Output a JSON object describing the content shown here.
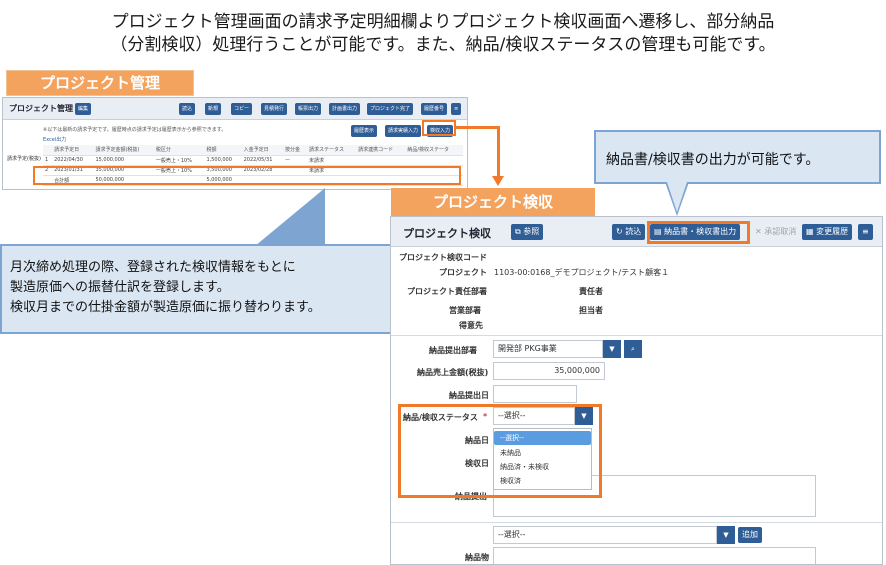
{
  "caption": {
    "line1": "プロジェクト管理画面の請求予定明細欄よりプロジェクト検収画面へ遷移し、部分納品",
    "line2": "（分割検収）処理行うことが可能です。また、納品/検収ステータスの管理も可能です。"
  },
  "pm": {
    "section_label": "プロジェクト管理",
    "window_title": "プロジェクト管理",
    "edit_button": "編集",
    "toolbar": [
      "読込",
      "新規",
      "コピー",
      "見積発行",
      "帳票出力",
      "計画書出力",
      "プロジェクト完了",
      "履歴番号"
    ],
    "history_button": "履歴表示",
    "invoice_button": "請求実績入力",
    "acceptance_button": "検収入力",
    "note": "※以下は最新の請求予定です。履歴時点の請求予定は履歴表示から参照できます。",
    "excel_link": "Excel出力",
    "side_label": "請求予定(税抜)",
    "columns": [
      "",
      "請求予定日",
      "請求予定金額(税抜)",
      "税区分",
      "税額",
      "入金予定日",
      "按分金",
      "請求ステータス",
      "請求連携コード",
      "納品/検収ステータ"
    ],
    "rows": [
      [
        "1",
        "2022/04/30",
        "15,000,000",
        "一般売上・10%",
        "1,500,000",
        "2022/05/31",
        "ー",
        "未請求",
        "",
        ""
      ],
      [
        "2",
        "2023/01/31",
        "35,000,000",
        "一般売上・10%",
        "3,500,000",
        "2023/02/28",
        "",
        "未請求",
        "",
        ""
      ],
      [
        "",
        "合計額",
        "50,000,000",
        "",
        "5,000,000",
        "",
        "",
        "",
        "",
        ""
      ]
    ]
  },
  "callouts": {
    "output": "納品書/検収書の出力が可能です。",
    "monthly_line1": "月次締め処理の際、登録された検収情報をもとに",
    "monthly_line2": "製造原価への振替仕訳を登録します。",
    "monthly_line3": "検収月までの仕掛金額が製造原価に振り替わります。"
  },
  "pa": {
    "section_label": "プロジェクト検収",
    "window_title": "プロジェクト検収",
    "ref_button": "参照",
    "load_button": "読込",
    "output_button": "納品書・検収書出力",
    "cancel_button": "承認取消",
    "history_button": "変更履歴",
    "fields": {
      "code_label": "プロジェクト検収コード",
      "project_label": "プロジェクト",
      "project_value": "1103-00:0168_デモプロジェクト/テスト顧客１",
      "resp_dept_label": "プロジェクト責任部署",
      "resp_person_label": "責任者",
      "sales_dept_label": "営業部署",
      "manager_label": "担当者",
      "customer_label": "得意先",
      "delivery_dept_label": "納品提出部署",
      "delivery_dept_value": "開発部 PKG事業",
      "sales_amount_label": "納品売上金額(税抜)",
      "sales_amount_value": "35,000,000",
      "submit_date_label": "納品提出日",
      "status_label": "納品/検収ステータス",
      "required_mark": "*",
      "status_value": "--選択--",
      "delivery_date_label": "納品日",
      "acceptance_date_label": "検収日",
      "delivery_note_label": "納品提出",
      "select_placeholder": "--選択--",
      "add_button": "追加",
      "item_label": "納品物"
    },
    "status_options": [
      "--選択--",
      "未納品",
      "納品済・未検収",
      "検収済"
    ]
  },
  "colors": {
    "accent_orange": "#f07a28",
    "section_orange": "#f4a35f",
    "button_blue": "#2f5d96",
    "callout_fill": "#dbe6f3",
    "callout_border": "#7ea5d2"
  }
}
